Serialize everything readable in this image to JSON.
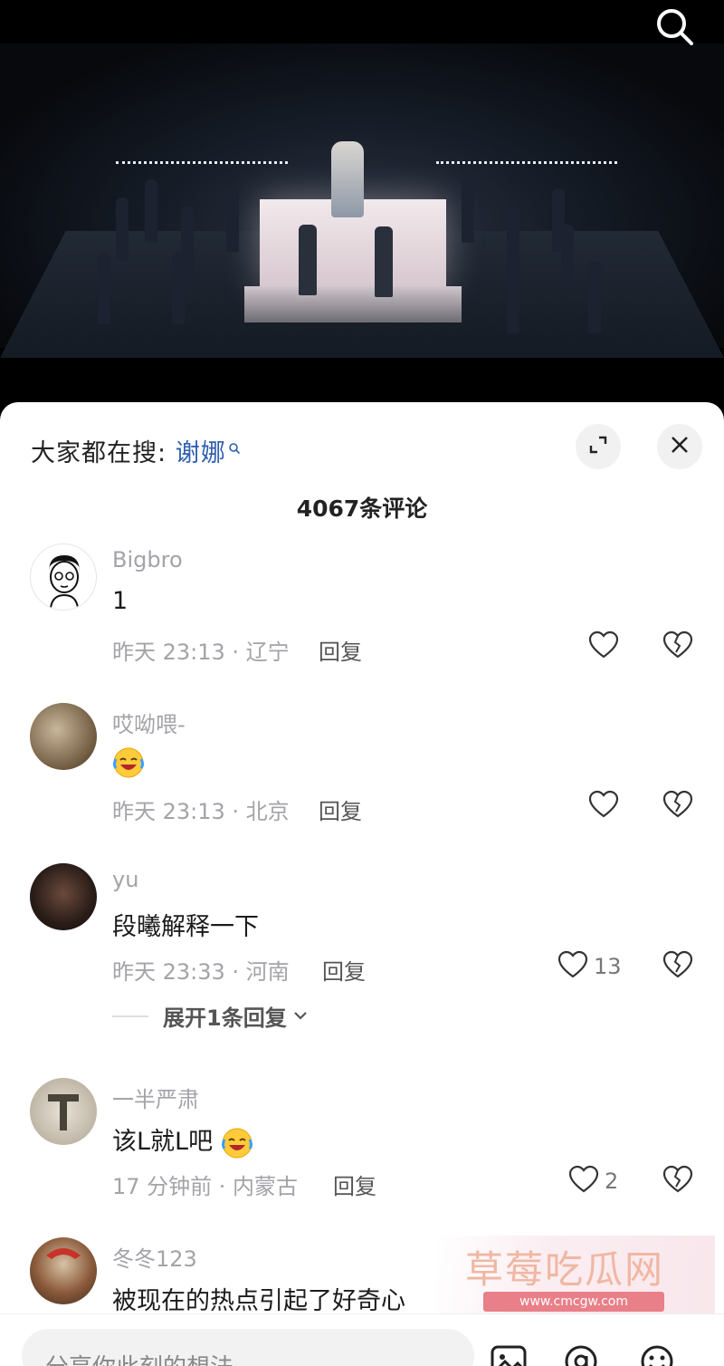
{
  "panel": {
    "hot_search_prefix": "大家都在搜:",
    "hot_search_keyword": "谢娜",
    "comment_count": "4067条评论"
  },
  "comments": [
    {
      "user": "Bigbro",
      "text": "1",
      "time": "昨天 23:13 · 辽宁",
      "reply": "回复",
      "likes": ""
    },
    {
      "user": "哎呦喂-",
      "text": "",
      "emoji": "laughing-crying-emoji",
      "time": "昨天 23:13 · 北京",
      "reply": "回复",
      "likes": ""
    },
    {
      "user": "yu",
      "text": "段曦解释一下",
      "time": "昨天 23:33 · 河南",
      "reply": "回复",
      "likes": "13"
    },
    {
      "user": "一半严肃",
      "text": "该L就L吧",
      "emoji": "laughing-crying-emoji",
      "time": "17 分钟前 · 内蒙古",
      "reply": "回复",
      "likes": "2"
    },
    {
      "user": "冬冬123",
      "text": "被现在的热点引起了好奇心"
    }
  ],
  "expand_replies": "展开1条回复",
  "watermark": {
    "title": "草莓吃瓜网",
    "url": "www.cmcgw.com"
  },
  "input": {
    "placeholder": "分享你此刻的想法"
  },
  "icons": [
    "search-icon",
    "expand-icon",
    "close-icon",
    "heart-icon",
    "broken-heart-icon",
    "image-icon",
    "at-icon",
    "emoji-icon",
    "chevron-down-icon"
  ],
  "colors": {
    "keyword": "#2f5fae",
    "muted": "#a3a3a8",
    "text": "#1b1b1b"
  }
}
